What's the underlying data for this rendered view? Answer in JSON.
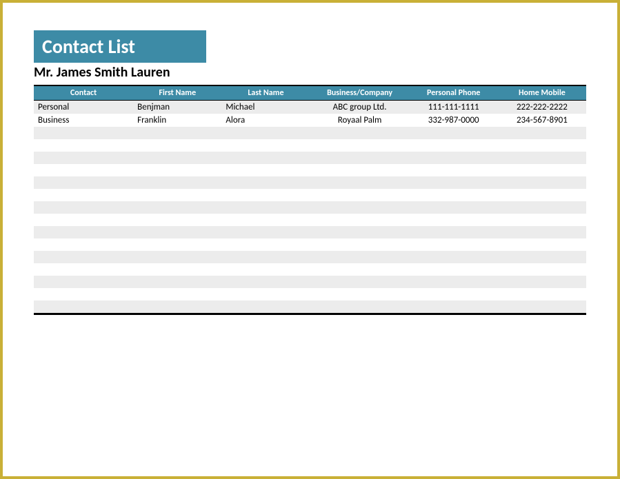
{
  "header": {
    "title": "Contact List",
    "subtitle": "Mr. James Smith Lauren"
  },
  "table": {
    "columns": [
      "Contact",
      "First Name",
      "Last Name",
      "Business/Company",
      "Personal Phone",
      "Home Mobile"
    ],
    "rows": [
      {
        "contact": "Personal",
        "first_name": "Benjman",
        "last_name": "Michael",
        "company": "ABC group Ltd.",
        "phone": "111-111-1111",
        "mobile": "222-222-2222"
      },
      {
        "contact": "Business",
        "first_name": "Franklin",
        "last_name": "Alora",
        "company": "Royaal Palm",
        "phone": "332-987-0000",
        "mobile": "234-567-8901"
      }
    ],
    "empty_rows": 15
  }
}
